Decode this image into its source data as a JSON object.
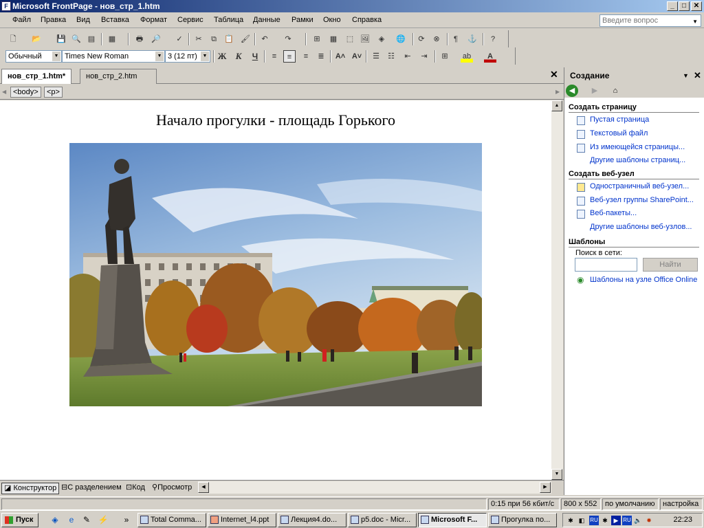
{
  "titlebar": {
    "title": "Microsoft FrontPage - нов_стр_1.htm",
    "icon": "frontpage-icon",
    "min": "_",
    "max": "□",
    "close": "✕"
  },
  "menu": [
    "Файл",
    "Правка",
    "Вид",
    "Вставка",
    "Формат",
    "Сервис",
    "Таблица",
    "Данные",
    "Рамки",
    "Окно",
    "Справка"
  ],
  "ask_box": {
    "placeholder": "Введите вопрос"
  },
  "format_toolbar": {
    "style": "Обычный",
    "font": "Times New Roman",
    "size": "3  (12 пт)",
    "bold": "Ж",
    "italic": "К",
    "underline": "Ч"
  },
  "tabs": [
    {
      "label": "нов_стр_1.htm*"
    },
    {
      "label": "нов_стр_2.htm"
    }
  ],
  "tags": [
    "<body>",
    "<p>"
  ],
  "document": {
    "heading": "Начало прогулки - площадь Горького"
  },
  "views": [
    "Конструктор",
    "С разделением",
    "Код",
    "Просмотр"
  ],
  "taskpane": {
    "title": "Создание",
    "sections": {
      "page": {
        "title": "Создать страницу",
        "links": [
          "Пустая страница",
          "Текстовый файл",
          "Из имеющейся страницы...",
          "Другие шаблоны страниц..."
        ]
      },
      "site": {
        "title": "Создать веб-узел",
        "links": [
          "Одностраничный веб-узел...",
          "Веб-узел группы SharePoint...",
          "Веб-пакеты...",
          "Другие шаблоны веб-узлов..."
        ]
      },
      "templates": {
        "title": "Шаблоны",
        "search_label": "Поиск в сети:",
        "search_button": "Найти",
        "online_link": "Шаблоны на узле Office Online"
      }
    }
  },
  "status": {
    "download": "0:15 при 56 кбит/с",
    "size": "800 x 552",
    "mode": "по умолчанию",
    "custom": "настройка"
  },
  "taskbar": {
    "start": "Пуск",
    "tasks": [
      "Total Comma...",
      "Internet_l4.ppt",
      "Лекция4.do...",
      "p5.doc - Micr...",
      "Microsoft F...",
      "Прогулка по..."
    ],
    "lang": "RU",
    "clock": "22:23"
  }
}
